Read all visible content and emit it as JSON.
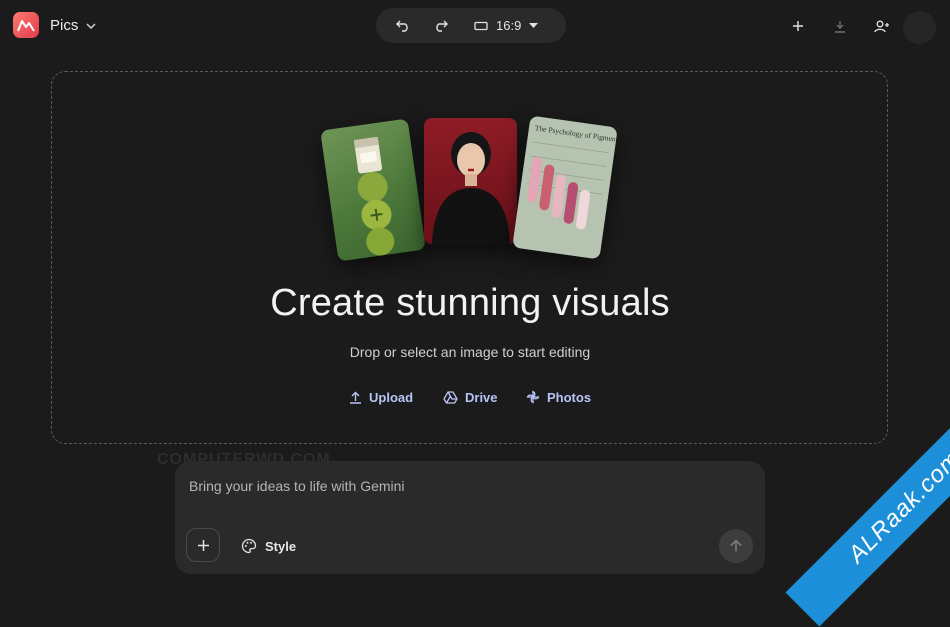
{
  "header": {
    "app_name": "Pics",
    "aspect_ratio": "16:9",
    "logo_icon": "pics-logo-icon",
    "accent_color": "#e64a57"
  },
  "hero": {
    "title": "Create stunning visuals",
    "subtitle": "Drop or select an image to start editing",
    "cards": [
      {
        "name": "candle-tomato-image"
      },
      {
        "name": "portrait-image"
      },
      {
        "name": "psychology-of-pigment-poster",
        "text": "The Psychology of Pigment"
      }
    ]
  },
  "sources": {
    "upload": "Upload",
    "drive": "Drive",
    "photos": "Photos",
    "link_color": "#b8c5f6"
  },
  "prompt": {
    "placeholder": "Bring your ideas to life with Gemini",
    "style_label": "Style"
  },
  "watermarks": {
    "text_left": "COMPUTERWD.COM",
    "ribbon": "ALRaak.com"
  }
}
